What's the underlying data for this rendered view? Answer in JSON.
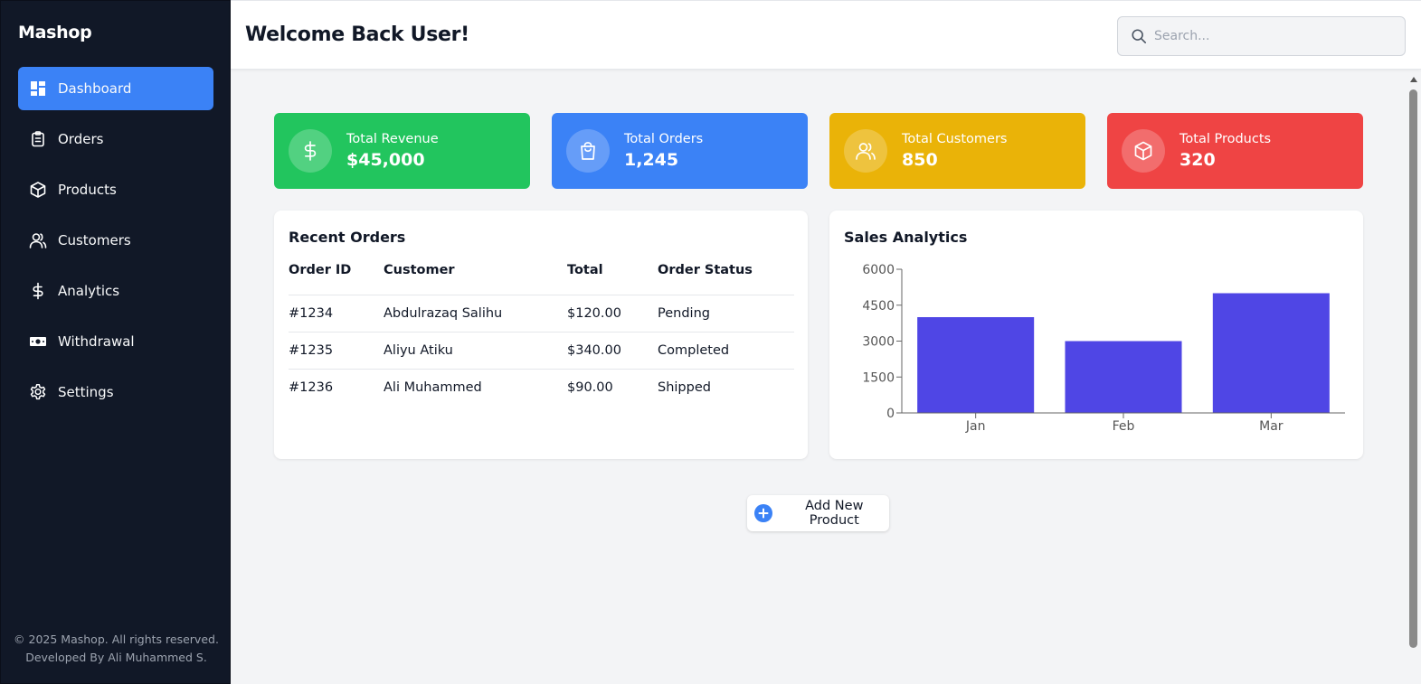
{
  "sidebar": {
    "brand": "Mashop",
    "items": [
      {
        "label": "Dashboard",
        "icon": "dashboard-icon",
        "active": true
      },
      {
        "label": "Orders",
        "icon": "clipboard-icon"
      },
      {
        "label": "Products",
        "icon": "box-icon"
      },
      {
        "label": "Customers",
        "icon": "users-icon"
      },
      {
        "label": "Analytics",
        "icon": "dollar-icon"
      },
      {
        "label": "Withdrawal",
        "icon": "banknote-icon"
      },
      {
        "label": "Settings",
        "icon": "gear-icon"
      }
    ],
    "footer_line1": "© 2025 Mashop. All rights reserved.",
    "footer_line2": "Developed By Ali Muhammed S."
  },
  "header": {
    "title": "Welcome Back User!",
    "search_placeholder": "Search..."
  },
  "stats": [
    {
      "label": "Total Revenue",
      "value": "$45,000",
      "color": "#22c55e",
      "icon": "dollar-icon"
    },
    {
      "label": "Total Orders",
      "value": "1,245",
      "color": "#3b82f6",
      "icon": "shopping-bag-icon"
    },
    {
      "label": "Total Customers",
      "value": "850",
      "color": "#eab308",
      "icon": "users-icon"
    },
    {
      "label": "Total Products",
      "value": "320",
      "color": "#ef4444",
      "icon": "box-icon"
    }
  ],
  "recent_orders": {
    "title": "Recent Orders",
    "columns": [
      "Order ID",
      "Customer",
      "Total",
      "Order Status"
    ],
    "rows": [
      [
        "#1234",
        "Abdulrazaq Salihu",
        "$120.00",
        "Pending"
      ],
      [
        "#1235",
        "Aliyu Atiku",
        "$340.00",
        "Completed"
      ],
      [
        "#1236",
        "Ali Muhammed",
        "$90.00",
        "Shipped"
      ]
    ]
  },
  "sales": {
    "title": "Sales Analytics"
  },
  "chart_data": {
    "type": "bar",
    "categories": [
      "Jan",
      "Feb",
      "Mar"
    ],
    "values": [
      4000,
      3000,
      5000
    ],
    "yticks": [
      0,
      1500,
      3000,
      4500,
      6000
    ],
    "ylim": [
      0,
      6000
    ],
    "bar_color": "#4f46e5",
    "title": "",
    "xlabel": "",
    "ylabel": ""
  },
  "actions": {
    "add_product": "Add New Product"
  }
}
